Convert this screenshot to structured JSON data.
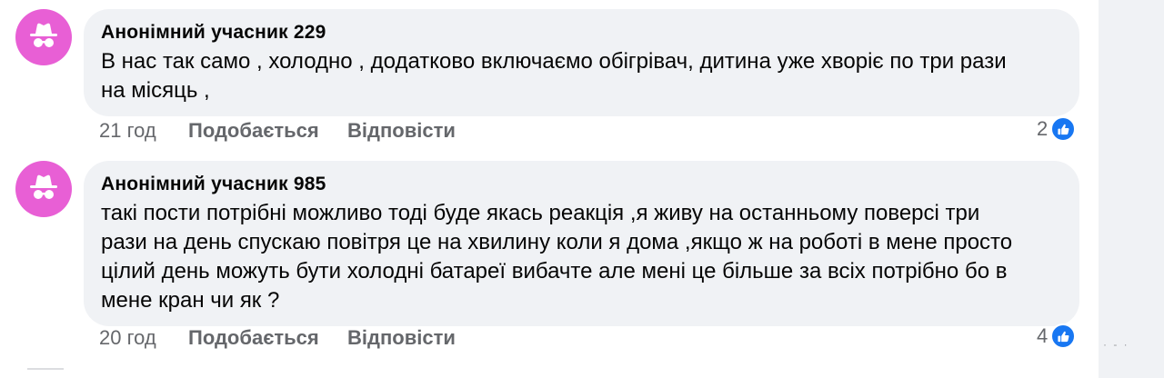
{
  "comments": [
    {
      "author": "Анонімний учасник 229",
      "text": "В нас так само , холодно , додатково включаємо обігрівач, дитина уже хворіє по три рази\nна місяць ,",
      "time": "21 год",
      "like_label": "Подобається",
      "reply_label": "Відповісти",
      "reaction_count": "2",
      "reaction_icon": "like-icon"
    },
    {
      "author": "Анонімний учасник 985",
      "text": "такі пости потрібні можливо тоді буде якась реакція ,я живу на останньому поверсі три\nрази на день спускаю повітря це на хвилину коли я дома ,якщо ж на роботі в мене просто\nцілий день можуть бути холодні батареї вибачте але мені це більше за всіх потрібно бо в\nмене кран чи як ?",
      "time": "20 год",
      "like_label": "Подобається",
      "reply_label": "Відповісти",
      "reaction_count": "4",
      "reaction_icon": "like-icon"
    }
  ],
  "colors": {
    "avatar_bg": "#e85fd5",
    "bubble_bg": "#f0f2f5",
    "reaction_blue": "#1877f2",
    "secondary_text": "#65676b"
  },
  "icons": [
    "anonymous-avatar-icon",
    "like-icon"
  ]
}
